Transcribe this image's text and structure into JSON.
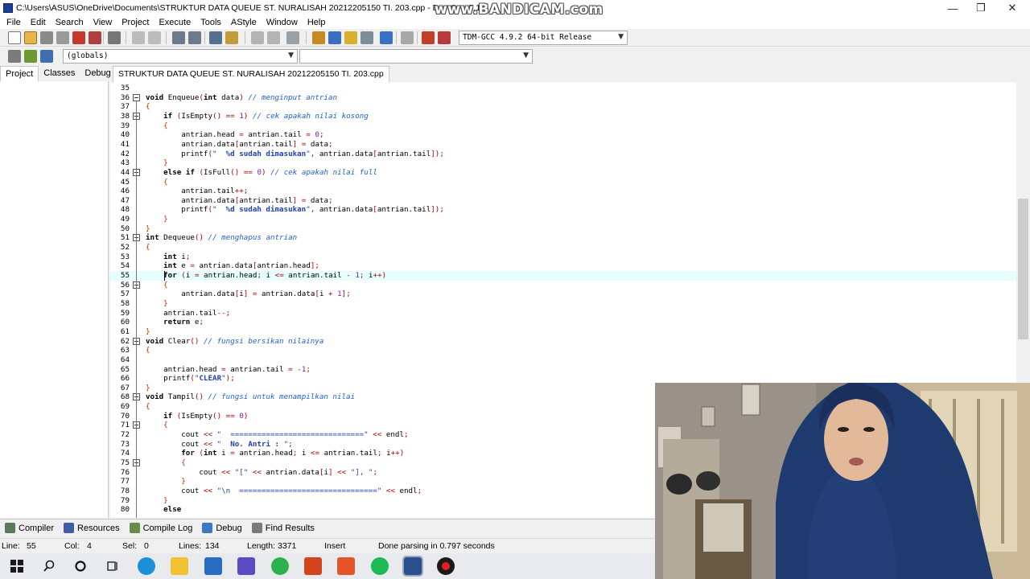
{
  "window": {
    "title": "C:\\Users\\ASUS\\OneDrive\\Documents\\STRUKTUR DATA QUEUE ST. NURALISAH 20212205150  TI. 203.cpp - Dev-C++ 5.11",
    "watermark": "www.BANDICAM.com",
    "minimize_label": "—",
    "restore_label": "❐",
    "close_label": "✕"
  },
  "menu": [
    "File",
    "Edit",
    "Search",
    "View",
    "Project",
    "Execute",
    "Tools",
    "AStyle",
    "Window",
    "Help"
  ],
  "toolbar": {
    "compiler_select": "TDM-GCC 4.9.2 64-bit Release",
    "scope_select": "(globals)",
    "symbol_select": ""
  },
  "left_tabs": [
    "Project",
    "Classes",
    "Debug"
  ],
  "editor_tab": "STRUKTUR DATA QUEUE ST. NURALISAH 20212205150  TI. 203.cpp",
  "code_lines": [
    {
      "n": "35",
      "c": ""
    },
    {
      "n": "36",
      "c": "void Enqueue(int data) // menginput antrian"
    },
    {
      "n": "37",
      "c": "{"
    },
    {
      "n": "38",
      "c": "    if (IsEmpty() == 1) // cek apakah nilai kosong"
    },
    {
      "n": "39",
      "c": "    {"
    },
    {
      "n": "40",
      "c": "        antrian.head = antrian.tail = 0;"
    },
    {
      "n": "41",
      "c": "        antrian.data[antrian.tail] = data;"
    },
    {
      "n": "42",
      "c": "        printf(\"  %d sudah dimasukan\", antrian.data[antrian.tail]);"
    },
    {
      "n": "43",
      "c": "    }"
    },
    {
      "n": "44",
      "c": "    else if (IsFull() == 0) // cek apakah nilai full"
    },
    {
      "n": "45",
      "c": "    {"
    },
    {
      "n": "46",
      "c": "        antrian.tail++;"
    },
    {
      "n": "47",
      "c": "        antrian.data[antrian.tail] = data;"
    },
    {
      "n": "48",
      "c": "        printf(\"  %d sudah dimasukan\", antrian.data[antrian.tail]);"
    },
    {
      "n": "49",
      "c": "    }"
    },
    {
      "n": "50",
      "c": "}"
    },
    {
      "n": "51",
      "c": "int Dequeue() // menghapus antrian"
    },
    {
      "n": "52",
      "c": "{"
    },
    {
      "n": "53",
      "c": "    int i;"
    },
    {
      "n": "54",
      "c": "    int e = antrian.data[antrian.head];"
    },
    {
      "n": "55",
      "c": "    for (i = antrian.head; i <= antrian.tail - 1; i++)"
    },
    {
      "n": "56",
      "c": "    {"
    },
    {
      "n": "57",
      "c": "        antrian.data[i] = antrian.data[i + 1];"
    },
    {
      "n": "58",
      "c": "    }"
    },
    {
      "n": "59",
      "c": "    antrian.tail--;"
    },
    {
      "n": "60",
      "c": "    return e;"
    },
    {
      "n": "61",
      "c": "}"
    },
    {
      "n": "62",
      "c": "void Clear() // fungsi bersikan nilainya"
    },
    {
      "n": "63",
      "c": "{"
    },
    {
      "n": "64",
      "c": ""
    },
    {
      "n": "65",
      "c": "    antrian.head = antrian.tail = -1;"
    },
    {
      "n": "66",
      "c": "    printf(\"CLEAR\");"
    },
    {
      "n": "67",
      "c": "}"
    },
    {
      "n": "68",
      "c": "void Tampil() // fungsi untuk menampilkan nilai"
    },
    {
      "n": "69",
      "c": "{"
    },
    {
      "n": "70",
      "c": "    if (IsEmpty() == 0)"
    },
    {
      "n": "71",
      "c": "    {"
    },
    {
      "n": "72",
      "c": "        cout << \"  ==============================\" << endl;"
    },
    {
      "n": "73",
      "c": "        cout << \"  No. Antri : \";"
    },
    {
      "n": "74",
      "c": "        for (int i = antrian.head; i <= antrian.tail; i++)"
    },
    {
      "n": "75",
      "c": "        {"
    },
    {
      "n": "76",
      "c": "            cout << \"[\" << antrian.data[i] << \"], \";"
    },
    {
      "n": "77",
      "c": "        }"
    },
    {
      "n": "78",
      "c": "        cout << \"\\n  ===============================\" << endl;"
    },
    {
      "n": "79",
      "c": "    }"
    },
    {
      "n": "80",
      "c": "    else"
    }
  ],
  "bottom_tabs": [
    "Compiler",
    "Resources",
    "Compile Log",
    "Debug",
    "Find Results"
  ],
  "status": {
    "line_label": "Line:",
    "line_value": "55",
    "col_label": "Col:",
    "col_value": "4",
    "sel_label": "Sel:",
    "sel_value": "0",
    "lines_label": "Lines:",
    "lines_value": "134",
    "length_label": "Length:",
    "length_value": "3371",
    "mode": "Insert",
    "message": "Done parsing in 0.797 seconds"
  },
  "taskbar_icons": [
    "windows-start",
    "search",
    "task-view",
    "widgets",
    "edge",
    "file-explorer",
    "mail",
    "visual-studio",
    "whatsapp",
    "office",
    "office-2",
    "spotify",
    "dev-cpp",
    "bandicam-record"
  ]
}
